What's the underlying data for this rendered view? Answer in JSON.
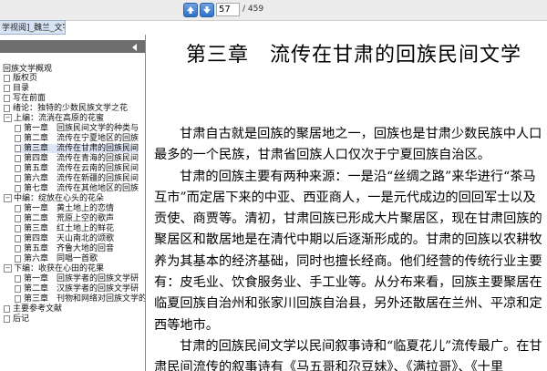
{
  "toolbar": {
    "page_current": "57",
    "page_total": "/ 459"
  },
  "tab": {
    "label": "学视阅]_魏兰_文字版"
  },
  "tree": {
    "root": "回族文学概观",
    "items": [
      {
        "label": "版权页"
      },
      {
        "label": "目录"
      },
      {
        "label": "写在前面"
      },
      {
        "label": "绪论：独特的少数民族文学之花"
      },
      {
        "label": "上编：流淌在高原的花蜜"
      },
      {
        "label": "第一章　回族民间文学的种类与"
      },
      {
        "label": "第二章　流传在宁夏地区的回族"
      },
      {
        "label": "第三章　流传在甘肃的回族民间"
      },
      {
        "label": "第四章　流传在青海的回族民间"
      },
      {
        "label": "第五章　流传在云南的回族民间"
      },
      {
        "label": "第六章　流传在新疆的回族民间"
      },
      {
        "label": "第七章　流传在其他地区的回族"
      },
      {
        "label": "中编：绽放在心头的花朵"
      },
      {
        "label": "第一章　黄土地上的恋情"
      },
      {
        "label": "第二章　荒原上空的歌声"
      },
      {
        "label": "第三章　红土地上的鲜花"
      },
      {
        "label": "第四章　天山南北的颂歌"
      },
      {
        "label": "第五章　齐鲁大地的回音"
      },
      {
        "label": "第六章　同唱一首歌"
      },
      {
        "label": "下编：收获在心田的花果"
      },
      {
        "label": "第一章　回族学者的回族文学研"
      },
      {
        "label": "第二章　汉族学者的回族文学研"
      },
      {
        "label": "第三章　刊物和网络对回族文学的"
      },
      {
        "label": "主要参考文献"
      },
      {
        "label": "后记"
      }
    ]
  },
  "document": {
    "title": "第三章　流传在甘肃的回族民间文学",
    "paragraphs": [
      "甘肃自古就是回族的聚居地之一，回族也是甘肃少数民族中人口最多的一个民族，甘肃省回族人口仅次于宁夏回族自治区。",
      "甘肃的回族主要有两种来源：一是沿“丝绸之路”来华进行“茶马互市”而定居下来的中亚、西亚商人，一是元代成边的回回军士以及贡使、商贾等。清初，甘肃回族已形成大片聚居区，现在甘肃回族的聚居区和散居地是在清代中期以后逐渐形成的。甘肃的回族以农耕牧养为其基本的经济基础，同时也擅长经商。他们经营的传统行业主要有：皮毛业、饮食服务业、手工业等。从分布来看，回族主要聚居在临夏回族自治州和张家川回族自治县，另外还散居在兰州、平凉和定西等地市。",
      "甘肃的回族民间文学以民间叙事诗和“临夏花儿”流传最广。在甘肃民间流传的叙事诗有《马五哥和尕豆妹》、《满拉哥》、《十里"
    ]
  }
}
